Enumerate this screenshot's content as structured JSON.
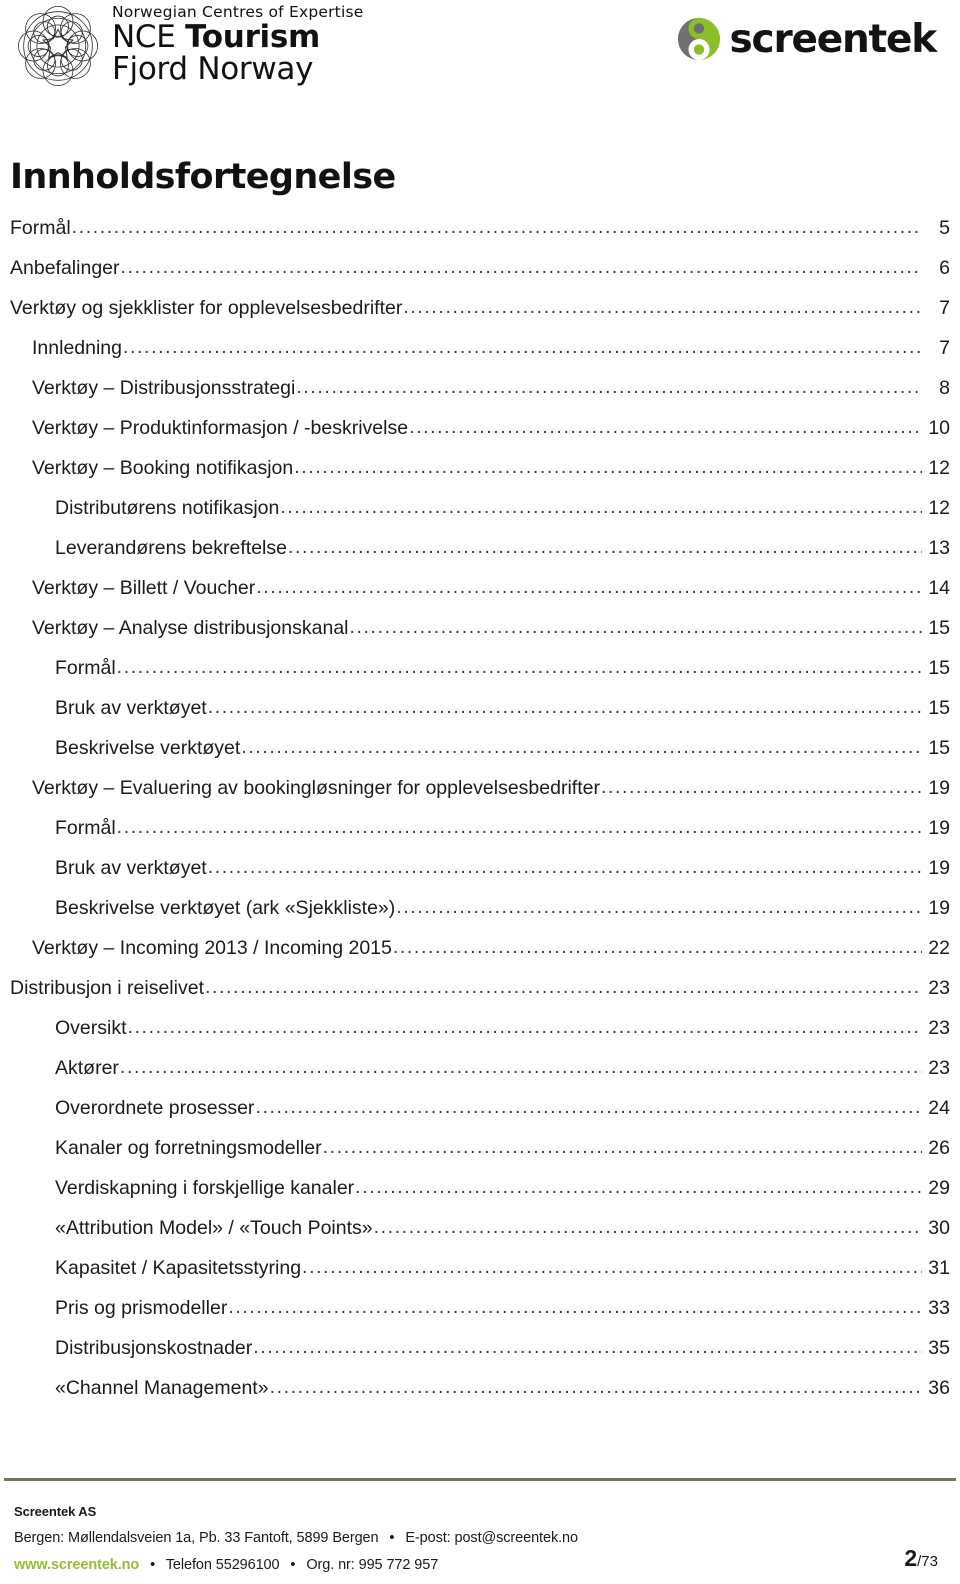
{
  "header": {
    "nce_logo": {
      "tagline": "Norwegian Centres of Expertise",
      "line1_thin": "NCE ",
      "line1_thick": "Tourism",
      "line2": "Fjord Norway",
      "mark_name": "nce-mandala-mark"
    },
    "screentek_logo": {
      "wordmark": "screentek",
      "mark_name": "screentek-circle-mark",
      "color_gray": "#6f7072",
      "color_green": "#8cbe2a"
    }
  },
  "toc": {
    "title": "Innholdsfortegnelse",
    "leader_char": ".",
    "entries": [
      {
        "label": "Formål",
        "page": "5",
        "level": 1
      },
      {
        "label": "Anbefalinger",
        "page": "6",
        "level": 1
      },
      {
        "label": "Verktøy og sjekklister for opplevelsesbedrifter",
        "page": "7",
        "level": 1
      },
      {
        "label": "Innledning",
        "page": "7",
        "level": 2
      },
      {
        "label": "Verktøy – Distribusjonsstrategi",
        "page": "8",
        "level": 2
      },
      {
        "label": "Verktøy – Produktinformasjon / -beskrivelse",
        "page": "10",
        "level": 2
      },
      {
        "label": "Verktøy – Booking notifikasjon",
        "page": "12",
        "level": 2
      },
      {
        "label": "Distributørens notifikasjon",
        "page": "12",
        "level": 3
      },
      {
        "label": "Leverandørens bekreftelse",
        "page": "13",
        "level": 3
      },
      {
        "label": "Verktøy – Billett / Voucher",
        "page": "14",
        "level": 2
      },
      {
        "label": "Verktøy – Analyse distribusjonskanal",
        "page": "15",
        "level": 2
      },
      {
        "label": "Formål",
        "page": "15",
        "level": 3
      },
      {
        "label": "Bruk av verktøyet",
        "page": "15",
        "level": 3
      },
      {
        "label": "Beskrivelse verktøyet",
        "page": "15",
        "level": 3
      },
      {
        "label": "Verktøy – Evaluering av bookingløsninger for opplevelsesbedrifter",
        "page": "19",
        "level": 2
      },
      {
        "label": "Formål",
        "page": "19",
        "level": 3
      },
      {
        "label": "Bruk av verktøyet",
        "page": "19",
        "level": 3
      },
      {
        "label": "Beskrivelse verktøyet (ark «Sjekkliste»)",
        "page": "19",
        "level": 3
      },
      {
        "label": "Verktøy – Incoming 2013 / Incoming 2015",
        "page": "22",
        "level": 2
      },
      {
        "label": "Distribusjon i reiselivet",
        "page": "23",
        "level": 1
      },
      {
        "label": "Oversikt",
        "page": "23",
        "level": 3
      },
      {
        "label": "Aktører",
        "page": "23",
        "level": 3
      },
      {
        "label": "Overordnete prosesser",
        "page": "24",
        "level": 3
      },
      {
        "label": "Kanaler og forretningsmodeller",
        "page": "26",
        "level": 3
      },
      {
        "label": "Verdiskapning i forskjellige kanaler",
        "page": "29",
        "level": 3
      },
      {
        "label": "«Attribution Model» / «Touch Points»",
        "page": "30",
        "level": 3
      },
      {
        "label": "Kapasitet / Kapasitetsstyring",
        "page": "31",
        "level": 3
      },
      {
        "label": "Pris og prismodeller",
        "page": "33",
        "level": 3
      },
      {
        "label": "Distribusjonskostnader",
        "page": "35",
        "level": 3
      },
      {
        "label": "«Channel Management»",
        "page": "36",
        "level": 3
      }
    ]
  },
  "footer": {
    "company": "Screentek AS",
    "address": "Bergen: Møllendalsveien 1a, Pb. 33 Fantoft, 5899 Bergen",
    "separator": "•",
    "email": "E-post: post@screentek.no",
    "website": "www.screentek.no",
    "phone": "Telefon 55296100",
    "orgnr": "Org. nr: 995 772 957",
    "rule_color": "#747463",
    "page_current": "2",
    "page_total": "/73"
  }
}
